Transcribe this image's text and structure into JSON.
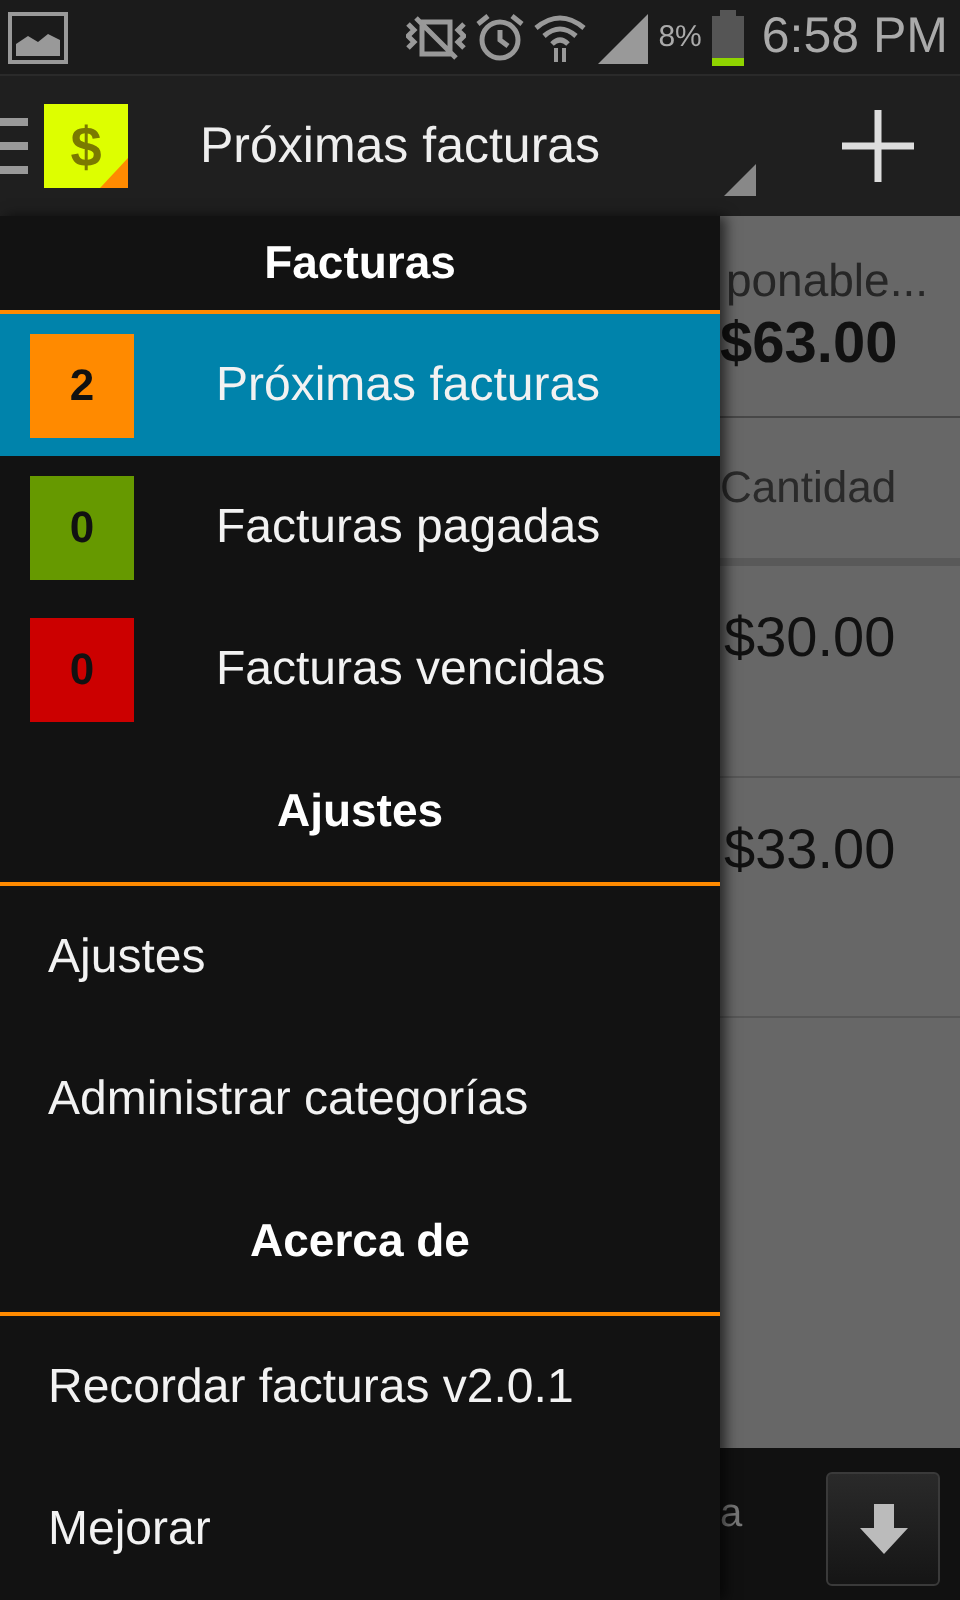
{
  "status_bar": {
    "battery_text": "8%",
    "time": "6:58 PM"
  },
  "action_bar": {
    "logo_text": "$",
    "title": "Próximas facturas"
  },
  "drawer": {
    "sections": [
      {
        "title": "Facturas",
        "items": [
          {
            "kind": "counter",
            "count": "2",
            "color": "#ff8a00",
            "label": "Próximas facturas",
            "selected": true
          },
          {
            "kind": "counter",
            "count": "0",
            "color": "#669900",
            "label": "Facturas pagadas",
            "selected": false
          },
          {
            "kind": "counter",
            "count": "0",
            "color": "#cc0000",
            "label": "Facturas vencidas",
            "selected": false
          }
        ]
      },
      {
        "title": "Ajustes",
        "items": [
          {
            "kind": "plain",
            "label": "Ajustes",
            "selected": false
          },
          {
            "kind": "plain",
            "label": "Administrar categorías",
            "selected": false
          }
        ]
      },
      {
        "title": "Acerca de",
        "items": [
          {
            "kind": "plain",
            "label": "Recordar facturas v2.0.1",
            "selected": false
          },
          {
            "kind": "plain",
            "label": "Mejorar",
            "selected": false
          }
        ]
      }
    ]
  },
  "background": {
    "summary_text": "ponable...",
    "total": "$63.00",
    "column_header": "Cantidad",
    "amounts": [
      "$30.00",
      "$33.00"
    ],
    "footer_text": "a"
  }
}
